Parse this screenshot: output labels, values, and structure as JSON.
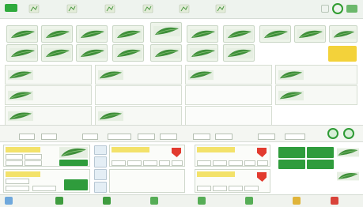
{
  "app": {
    "title": "",
    "logo_icon": "app-logo-icon"
  },
  "menu": [
    {
      "label": "",
      "icon": "file-icon"
    },
    {
      "label": "",
      "icon": "edit-icon"
    },
    {
      "label": "",
      "icon": "view-icon"
    },
    {
      "label": "",
      "icon": "order-icon"
    },
    {
      "label": "",
      "icon": "report-icon"
    },
    {
      "label": "",
      "icon": "settings-icon"
    }
  ],
  "catalog": {
    "row1": [
      "",
      "",
      "",
      "",
      "",
      "",
      "",
      "",
      "",
      ""
    ],
    "row2": [
      "",
      "",
      "",
      "",
      "",
      "",
      ""
    ],
    "promo": ""
  },
  "orders": {
    "cells": [
      {
        "label": "",
        "note": "",
        "filled": true
      },
      {
        "label": "",
        "note": "",
        "filled": true
      },
      {
        "label": "",
        "note": "",
        "filled": true
      },
      {
        "label": "",
        "note": "",
        "filled": true
      },
      {
        "label": "",
        "note": "",
        "filled": true
      },
      {
        "label": "",
        "note": "",
        "filled": false
      },
      {
        "label": "",
        "note": "",
        "filled": false
      },
      {
        "label": "",
        "note": "",
        "filled": true
      },
      {
        "label": "",
        "note": "",
        "filled": true
      },
      {
        "label": "",
        "note": "",
        "filled": true
      },
      {
        "label": "",
        "note": "",
        "filled": false
      },
      {
        "label": "",
        "note": "",
        "filled": false
      }
    ],
    "info": "",
    "page": ""
  },
  "status": {
    "fields": [
      {
        "label": "",
        "value": ""
      },
      {
        "label": "",
        "value": ""
      },
      {
        "label": "",
        "value": ""
      },
      {
        "label": "",
        "value": ""
      },
      {
        "label": "",
        "value": ""
      },
      {
        "label": "",
        "value": ""
      },
      {
        "label": "",
        "value": ""
      },
      {
        "label": "",
        "value": ""
      },
      {
        "label": "",
        "value": ""
      },
      {
        "label": "",
        "value": ""
      }
    ]
  },
  "panels": {
    "left_top_head": "",
    "left_top_values": [
      "",
      "",
      "",
      ""
    ],
    "left_bottom_head": "",
    "left_bottom_values": [
      "",
      "",
      ""
    ],
    "side_buttons": [
      "",
      "",
      "",
      ""
    ],
    "mid_top_head": "",
    "mid_top_values": [
      "",
      "",
      "",
      "",
      ""
    ],
    "right_top_head": "",
    "right_top_values": [
      "",
      "",
      "",
      "",
      ""
    ],
    "right_bottom_head": "",
    "right_bottom_values": [
      "",
      "",
      "",
      ""
    ],
    "green_buttons": [
      "",
      "",
      "",
      ""
    ]
  },
  "nav": [
    {
      "label": "",
      "icon": "home-icon"
    },
    {
      "label": "",
      "icon": "stock-icon"
    },
    {
      "label": "",
      "icon": "inventory-icon"
    },
    {
      "label": "",
      "icon": "customer-icon"
    },
    {
      "label": "",
      "icon": "supplier-icon"
    },
    {
      "label": "",
      "icon": "statistics-icon"
    },
    {
      "label": "",
      "icon": "help-icon"
    },
    {
      "label": "",
      "icon": "exit-icon"
    }
  ],
  "colors": {
    "accent": "#2f9c3c",
    "highlight": "#f3e26a",
    "alert": "#e23b2f",
    "promo": "#f3d23a"
  }
}
